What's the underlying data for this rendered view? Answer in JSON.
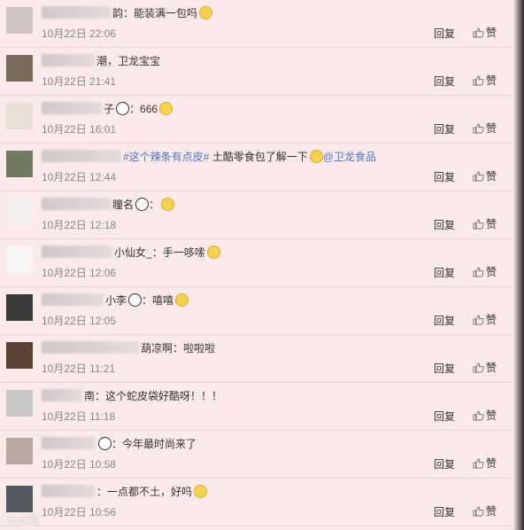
{
  "comments": [
    {
      "id": "c1",
      "suffix": "韵",
      "text": "：能装满一包吗",
      "time": "10月22日 22:06",
      "emoji_after": "smile-emoji"
    },
    {
      "id": "c2",
      "suffix": "",
      "text": "潮，卫龙宝宝",
      "time": "10月22日 21:41"
    },
    {
      "id": "c3",
      "prefix": "你是",
      "suffix": "子",
      "text": "：666",
      "time": "10月22日 16:01",
      "panda": true
    },
    {
      "id": "c4",
      "suffix": "",
      "text_topic": "#这个辣条有点皮#",
      "text_rest": " 土酷零食包了解一下",
      "mention": "@卫龙食品",
      "time": "10月22日 12:44"
    },
    {
      "id": "c5",
      "suffix": "瞳名",
      "text": "：",
      "time": "10月22日 12:18",
      "panda": true
    },
    {
      "id": "c6",
      "prefix": "是日",
      "suffix": "小仙女_",
      "text": "：手一哆嗦",
      "time": "10月22日 12:06"
    },
    {
      "id": "c7",
      "suffix": "小李",
      "text": "：嘻嘻",
      "time": "10月22日 12:05",
      "panda": true
    },
    {
      "id": "c8",
      "suffix": "葫凉啊",
      "text": "：啦啦啦",
      "time": "10月22日 11:21"
    },
    {
      "id": "c9",
      "suffix": "南",
      "text": "：这个蛇皮袋好酷呀！！！",
      "time": "10月22日 11:18"
    },
    {
      "id": "c10",
      "suffix": "",
      "text": "：今年最时尚来了",
      "time": "10月22日 10:58",
      "panda": true
    },
    {
      "id": "c11",
      "suffix": "",
      "text": "：一点都不土，好吗",
      "time": "10月22日 10:56"
    }
  ],
  "actions": {
    "reply": "回复",
    "like": "赞"
  },
  "watermark": "大众网"
}
